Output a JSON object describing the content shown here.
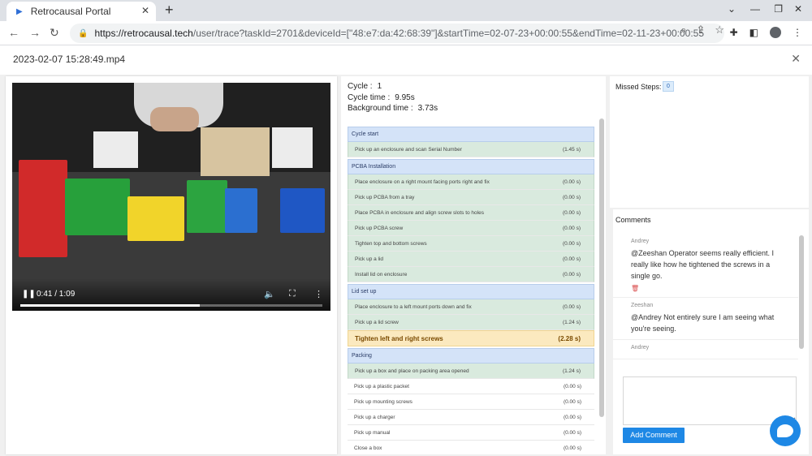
{
  "browser": {
    "tab_title": "Retrocausal Portal",
    "url_domain": "https://retrocausal.tech",
    "url_path": "/user/trace?taskId=2701&deviceId=[\"48:e7:da:42:68:39\"]&startTime=02-07-23+00:00:55&endTime=02-11-23+00:00:55"
  },
  "page": {
    "title": "2023-02-07 15:28:49.mp4"
  },
  "video": {
    "time_label": "0:41 / 1:09",
    "progress": 0.594
  },
  "meta": {
    "cycle_label": "Cycle :",
    "cycle_value": "1",
    "cycle_time_label": "Cycle time :",
    "cycle_time_value": "9.95s",
    "background_time_label": "Background time :",
    "background_time_value": "3.73s"
  },
  "steps": {
    "groups": [
      {
        "name": "Cycle start",
        "items": [
          {
            "label": "Pick up an enclosure and scan Serial Number",
            "time": "(1.45 s)",
            "state": "done"
          }
        ]
      },
      {
        "name": "PCBA Installation",
        "items": [
          {
            "label": "Place enclosure on a right mount facing ports right and fix",
            "time": "(0.00 s)",
            "state": "done"
          },
          {
            "label": "Pick up PCBA from a tray",
            "time": "(0.00 s)",
            "state": "done"
          },
          {
            "label": "Place PCBA in enclosure and align screw slots to holes",
            "time": "(0.00 s)",
            "state": "done"
          },
          {
            "label": "Pick up PCBA screw",
            "time": "(0.00 s)",
            "state": "done"
          },
          {
            "label": "Tighten top and bottom screws",
            "time": "(0.00 s)",
            "state": "done"
          },
          {
            "label": "Pick up a lid",
            "time": "(0.00 s)",
            "state": "done"
          },
          {
            "label": "Install lid on enclosure",
            "time": "(0.00 s)",
            "state": "done"
          }
        ]
      },
      {
        "name": "Lid set up",
        "items": [
          {
            "label": "Place enclosure to a left mount ports down and fix",
            "time": "(0.00 s)",
            "state": "done"
          },
          {
            "label": "Pick up a lid screw",
            "time": "(1.24 s)",
            "state": "done"
          },
          {
            "label": "Tighten left and right screws",
            "time": "(2.28 s)",
            "state": "active"
          }
        ]
      },
      {
        "name": "Packing",
        "items": [
          {
            "label": "Pick up a box and place on packing area opened",
            "time": "(1.24 s)",
            "state": "done"
          },
          {
            "label": "Pick up a plastic packet",
            "time": "(0.00 s)",
            "state": "pending"
          },
          {
            "label": "Pick up mounting screws",
            "time": "(0.00 s)",
            "state": "pending"
          },
          {
            "label": "Pick up a charger",
            "time": "(0.00 s)",
            "state": "pending"
          },
          {
            "label": "Pick up manual",
            "time": "(0.00 s)",
            "state": "pending"
          },
          {
            "label": "Close a box",
            "time": "(0.00 s)",
            "state": "pending"
          }
        ]
      }
    ]
  },
  "missed": {
    "label": "Missed Steps:",
    "count": "0"
  },
  "comments": {
    "header": "Comments",
    "items": [
      {
        "author": "Andrey",
        "text": "@Zeeshan Operator seems really efficient. I really like how he tightened the screws in a single go.",
        "deletable": true
      },
      {
        "author": "Zeeshan",
        "text": "@Andrey Not entirely sure I am seeing what you're seeing.",
        "deletable": false
      },
      {
        "author": "Andrey",
        "text": "",
        "deletable": false
      }
    ],
    "add_button": "Add Comment"
  }
}
